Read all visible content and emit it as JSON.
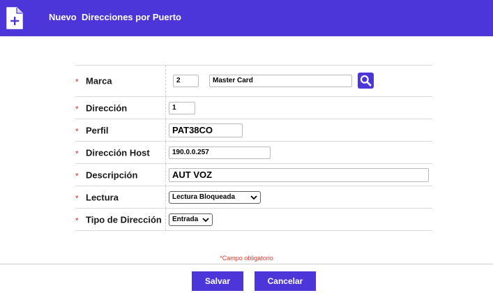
{
  "header": {
    "title": "Nuevo  Direcciones por Puerto",
    "icon": "new-document-icon",
    "background": "#4c36d9"
  },
  "form": {
    "required_marker": "*",
    "marca": {
      "label": "Marca",
      "code": "2",
      "name": "Master Card",
      "search_icon": "search-icon"
    },
    "direccion": {
      "label": "Dirección",
      "value": "1"
    },
    "perfil": {
      "label": "Perfil",
      "value": "PAT38CO"
    },
    "direccion_host": {
      "label": "Dirección Host",
      "value": "190.0.0.257"
    },
    "descripcion": {
      "label": "Descripción",
      "value": "AUT VOZ"
    },
    "lectura": {
      "label": "Lectura",
      "selected": "Lectura Bloqueada"
    },
    "tipo_direccion": {
      "label": "Tipo de Dirección",
      "selected": "Entrada"
    }
  },
  "required_note": "*Campo obligatorio",
  "buttons": {
    "save": "Salvar",
    "cancel": "Cancelar"
  },
  "colors": {
    "accent": "#4c36d9",
    "required": "#e0362c"
  }
}
